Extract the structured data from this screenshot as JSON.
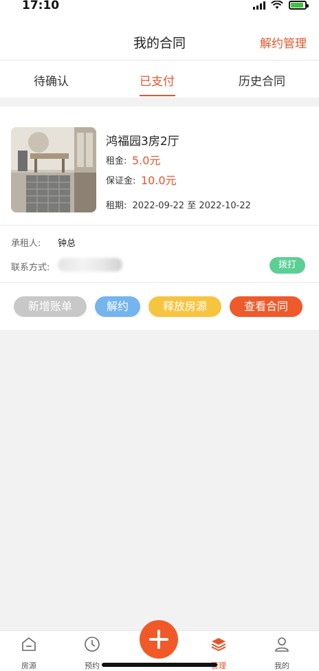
{
  "status": {
    "time": "17:10"
  },
  "nav": {
    "title": "我的合同",
    "action": "解约管理"
  },
  "tabs": [
    {
      "label": "待确认"
    },
    {
      "label": "已支付"
    },
    {
      "label": "历史合同"
    }
  ],
  "active_tab": "已支付",
  "contract": {
    "house_name": "鸿福园3房2厅",
    "rent_label": "租金:",
    "rent_value": "5.0元",
    "deposit_label": "保证金:",
    "deposit_value": "10.0元",
    "period_label": "租期:",
    "period_value": "2022-09-22 至 2022-10-22",
    "tenant_label": "承租人:",
    "tenant_value": "钟总",
    "contact_label": "联系方式:",
    "call_label": "拨打"
  },
  "actions": {
    "add_bill": "新增账单",
    "terminate": "解约",
    "release": "释放房源",
    "view_contract": "查看合同"
  },
  "colors": {
    "accent": "#e5552a",
    "add_bill": "#c8c8c8",
    "terminate": "#74b4ef",
    "release": "#f6c43f",
    "view_contract": "#ee5a2b",
    "call": "#5ccf95"
  },
  "tabbar": [
    {
      "label": "房源",
      "icon": "house-icon"
    },
    {
      "label": "预约",
      "icon": "clock-icon"
    },
    {
      "label": "",
      "icon": "plus-icon"
    },
    {
      "label": "管理",
      "icon": "layers-icon"
    },
    {
      "label": "我的",
      "icon": "user-icon"
    }
  ]
}
